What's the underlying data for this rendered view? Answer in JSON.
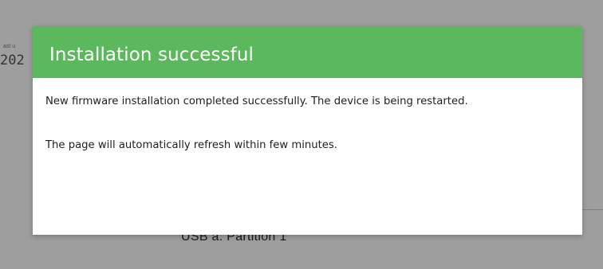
{
  "background": {
    "faint_label": "ast u",
    "faint_value": "202",
    "partition_label": "USB a: Partition 1"
  },
  "dialog": {
    "title": "Installation successful",
    "header_color": "#5cb85c",
    "message_1": "New firmware installation completed successfully. The device is being restarted.",
    "message_2": "The page will automatically refresh within few minutes."
  }
}
